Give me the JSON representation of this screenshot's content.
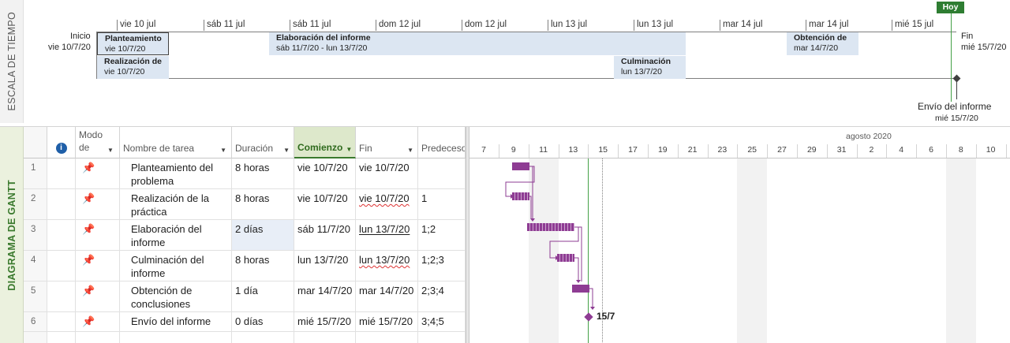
{
  "timeline": {
    "side_label": "ESCALA DE TIEMPO",
    "today_label": "Hoy",
    "ticks": [
      "vie 10 jul",
      "sáb 11 jul",
      "sáb 11 jul",
      "dom 12 jul",
      "dom 12 jul",
      "lun 13 jul",
      "lun 13 jul",
      "mar 14 jul",
      "mar 14 jul",
      "mié 15 jul"
    ],
    "start_label": "Inicio",
    "start_date": "vie 10/7/20",
    "end_label": "Fin",
    "end_date": "mié 15/7/20",
    "tasks": [
      {
        "title": "Planteamiento",
        "dates": "vie 10/7/20"
      },
      {
        "title": "Realización de",
        "dates": "vie 10/7/20"
      },
      {
        "title": "Elaboración del informe",
        "dates": "sáb 11/7/20 - lun 13/7/20"
      },
      {
        "title": "Culminación",
        "dates": "lun 13/7/20"
      },
      {
        "title": "Obtención de",
        "dates": "mar 14/7/20"
      }
    ],
    "milestone": {
      "title": "Envío del informe",
      "date": "mié 15/7/20"
    }
  },
  "gantt": {
    "side_label": "DIAGRAMA DE GANTT",
    "columns": {
      "info": "ⓘ",
      "mode": "Modo de",
      "name": "Nombre de tarea",
      "duration": "Duración",
      "start": "Comienzo",
      "finish": "Fin",
      "predecessors": "Predecesor"
    },
    "rows": [
      {
        "id": "1",
        "name": "Planteamiento del problema",
        "duration": "8 horas",
        "start": "vie 10/7/20",
        "finish": "vie 10/7/20",
        "pred": ""
      },
      {
        "id": "2",
        "name": "Realización de la práctica",
        "duration": "8 horas",
        "start": "vie 10/7/20",
        "finish": "vie 10/7/20",
        "pred": "1"
      },
      {
        "id": "3",
        "name": "Elaboración del informe",
        "duration": "2 días",
        "start": "sáb 11/7/20",
        "finish": "lun 13/7/20",
        "pred": "1;2"
      },
      {
        "id": "4",
        "name": "Culminación del informe",
        "duration": "8 horas",
        "start": "lun 13/7/20",
        "finish": "lun 13/7/20",
        "pred": "1;2;3"
      },
      {
        "id": "5",
        "name": "Obtención de conclusiones",
        "duration": "1 día",
        "start": "mar 14/7/20",
        "finish": "mar 14/7/20",
        "pred": "2;3;4"
      },
      {
        "id": "6",
        "name": "Envío del informe",
        "duration": "0 días",
        "start": "mié 15/7/20",
        "finish": "mié 15/7/20",
        "pred": "3;4;5"
      }
    ],
    "chart": {
      "month_label": "agosto 2020",
      "days": [
        "7",
        "9",
        "11",
        "13",
        "15",
        "17",
        "19",
        "21",
        "23",
        "25",
        "27",
        "29",
        "31",
        "2",
        "4",
        "6",
        "8",
        "10"
      ],
      "milestone_label": "15/7",
      "colors": {
        "bar": "#8e3c93",
        "today": "#44a047"
      }
    }
  }
}
